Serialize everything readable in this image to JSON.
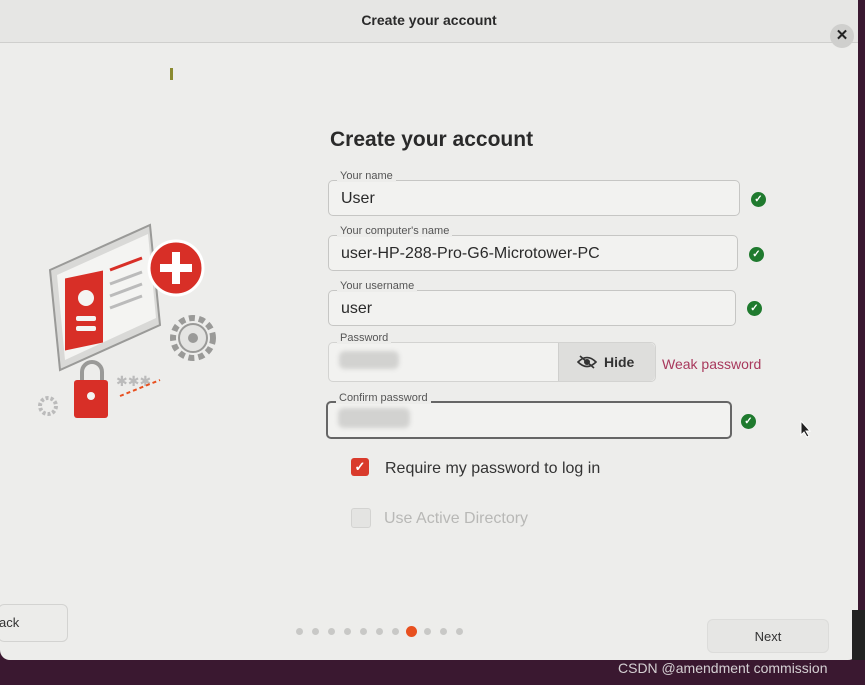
{
  "window": {
    "title": "Create your account"
  },
  "form": {
    "heading": "Create your account",
    "name": {
      "label": "Your name",
      "value": "User"
    },
    "computer": {
      "label": "Your computer's name",
      "value": "user-HP-288-Pro-G6-Microtower-PC"
    },
    "username": {
      "label": "Your username",
      "value": "user"
    },
    "password": {
      "label": "Password",
      "hide_label": "Hide",
      "strength": "Weak password"
    },
    "confirm": {
      "label": "Confirm password"
    },
    "require_password": {
      "label": "Require my password to log in",
      "checked": true
    },
    "active_directory": {
      "label": "Use Active Directory",
      "checked": false,
      "enabled": false
    }
  },
  "nav": {
    "back_label": "ack",
    "next_label": "Next",
    "total_steps": 11,
    "current_step": 8
  },
  "watermark": "CSDN @amendment commission",
  "colors": {
    "accent": "#e8501f",
    "check": "#1f7a2e",
    "weak": "#a8385c",
    "checkbox": "#d93a2b"
  }
}
